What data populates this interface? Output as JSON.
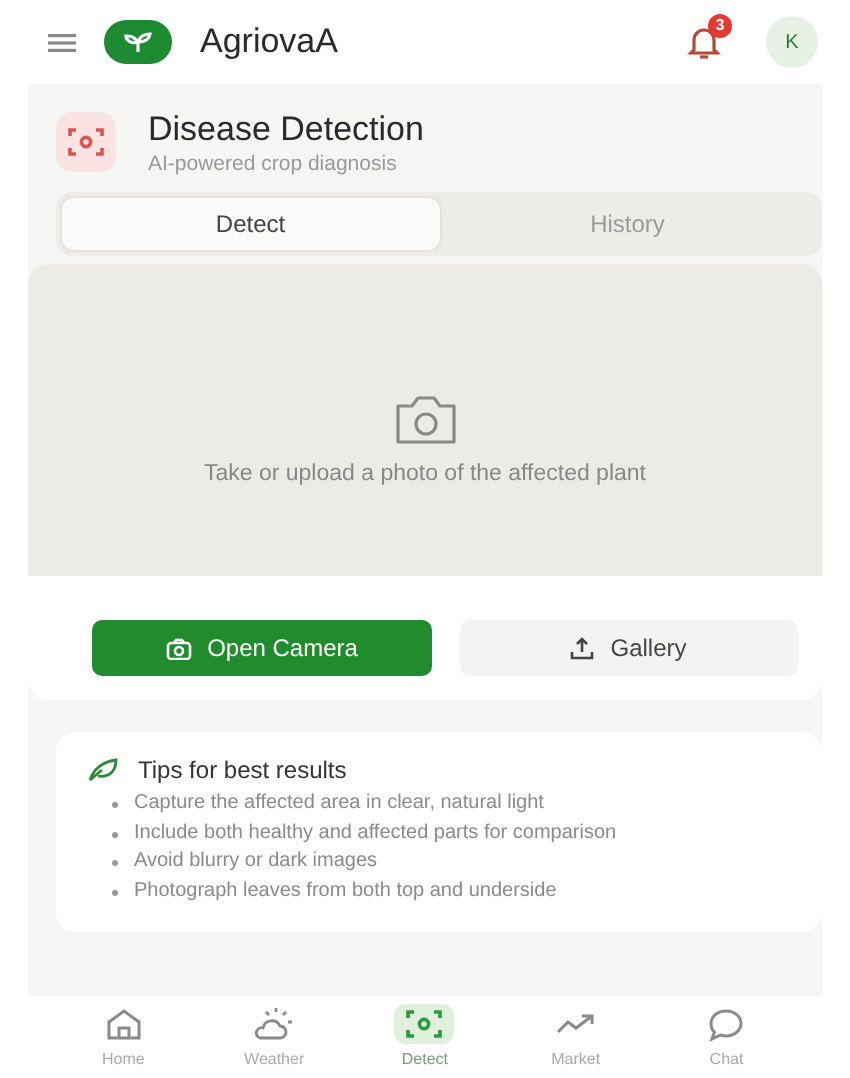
{
  "app_bar": {
    "brand": "AgriovaA",
    "notification_count": "3",
    "avatar": "K"
  },
  "page": {
    "title": "Disease Detection",
    "subtitle": "AI-powered crop diagnosis"
  },
  "tabs": [
    {
      "label": "Detect",
      "selected": true
    },
    {
      "label": "History",
      "selected": false
    }
  ],
  "upload": {
    "prompt": "Take or upload a photo of the affected plant",
    "buttons": [
      {
        "label": "Open Camera",
        "kind": "primary"
      },
      {
        "label": "Gallery",
        "kind": "secondary"
      }
    ]
  },
  "tips": {
    "title": "Tips for best results",
    "items": [
      "Capture the affected area in clear, natural light",
      "Include both healthy and affected parts for comparison",
      "Avoid blurry or dark images",
      "Photograph leaves from both top and underside"
    ]
  },
  "bottom_nav": [
    {
      "label": "Home",
      "kind": "home",
      "selected": false
    },
    {
      "label": "Weather",
      "kind": "weather",
      "selected": false
    },
    {
      "label": "Detect",
      "kind": "detect",
      "selected": true
    },
    {
      "label": "Market",
      "kind": "market",
      "selected": false
    },
    {
      "label": "Chat",
      "kind": "chat",
      "selected": false
    }
  ]
}
